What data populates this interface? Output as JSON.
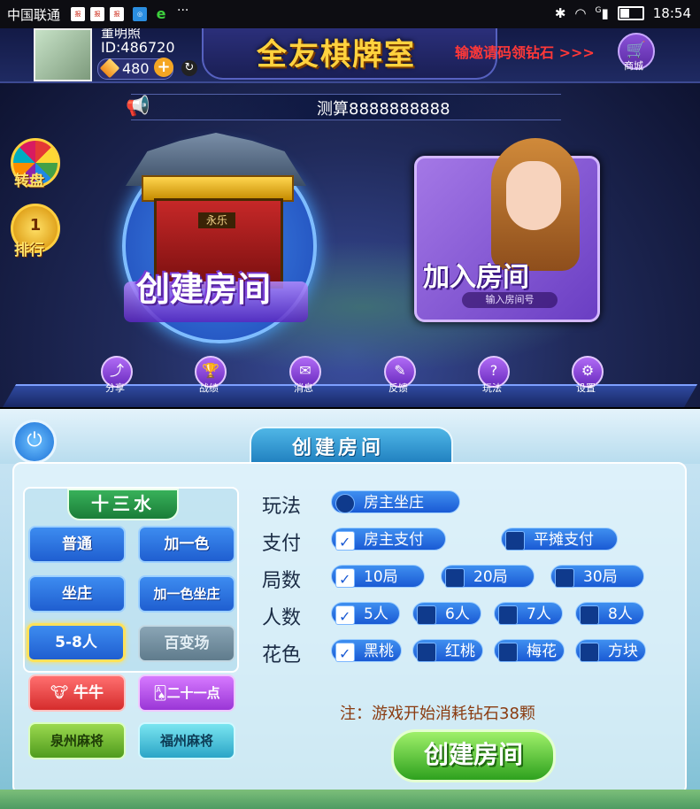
{
  "status_bar": {
    "carrier": "中国联通",
    "app_icons": [
      "news-icon",
      "news-icon",
      "news-icon",
      "browser-icon",
      "ie-icon"
    ],
    "more": "···",
    "time": "18:54",
    "signal_label": "G"
  },
  "header": {
    "player_name": "董明照",
    "player_id": "ID:486720",
    "diamonds": "480",
    "title": "全友棋牌室",
    "invite_text": "输邀请码领钻石 >>>",
    "shop_label": "商城"
  },
  "notice": {
    "text": "测算8888888888"
  },
  "side_buttons": {
    "wheel_label": "转盘",
    "rank_label": "排行",
    "rank_badge": "1"
  },
  "main_cards": {
    "create_label": "创建房间",
    "create_sign": "永乐",
    "join_label": "加入房间",
    "join_input_placeholder": "输入房间号"
  },
  "bottom_nav": [
    {
      "label": "分享",
      "icon": "share-icon"
    },
    {
      "label": "战绩",
      "icon": "trophy-icon"
    },
    {
      "label": "消息",
      "icon": "message-icon"
    },
    {
      "label": "反馈",
      "icon": "feedback-icon"
    },
    {
      "label": "玩法",
      "icon": "help-icon"
    },
    {
      "label": "设置",
      "icon": "settings-icon"
    }
  ],
  "dialog": {
    "title": "创建房间",
    "game_type": "十三水",
    "modes": [
      "普通",
      "加一色",
      "坐庄",
      "加一色坐庄",
      "5-8人",
      "百变场"
    ],
    "selected_mode": "5-8人",
    "other_games": [
      "牛牛",
      "二十一点",
      "泉州麻将",
      "福州麻将"
    ],
    "options": {
      "play_label": "玩法",
      "play_value": "房主坐庄",
      "pay_label": "支付",
      "pay_options": [
        {
          "label": "房主支付",
          "checked": true
        },
        {
          "label": "平摊支付",
          "checked": false
        }
      ],
      "rounds_label": "局数",
      "rounds_options": [
        {
          "label": "10局",
          "checked": true
        },
        {
          "label": "20局",
          "checked": false
        },
        {
          "label": "30局",
          "checked": false
        }
      ],
      "players_label": "人数",
      "players_options": [
        {
          "label": "5人",
          "checked": true
        },
        {
          "label": "6人",
          "checked": false
        },
        {
          "label": "7人",
          "checked": false
        },
        {
          "label": "8人",
          "checked": false
        }
      ],
      "suit_label": "花色",
      "suit_options": [
        {
          "label": "黑桃",
          "checked": true
        },
        {
          "label": "红桃",
          "checked": false
        },
        {
          "label": "梅花",
          "checked": false
        },
        {
          "label": "方块",
          "checked": false
        }
      ]
    },
    "note": "注：游戏开始消耗钻石38颗",
    "create_button": "创建房间"
  },
  "colors": {
    "accent_blue": "#1f5ed0",
    "title_gold": "#ffd23e",
    "invite_red": "#ff3838",
    "create_green": "#2ea11e"
  }
}
